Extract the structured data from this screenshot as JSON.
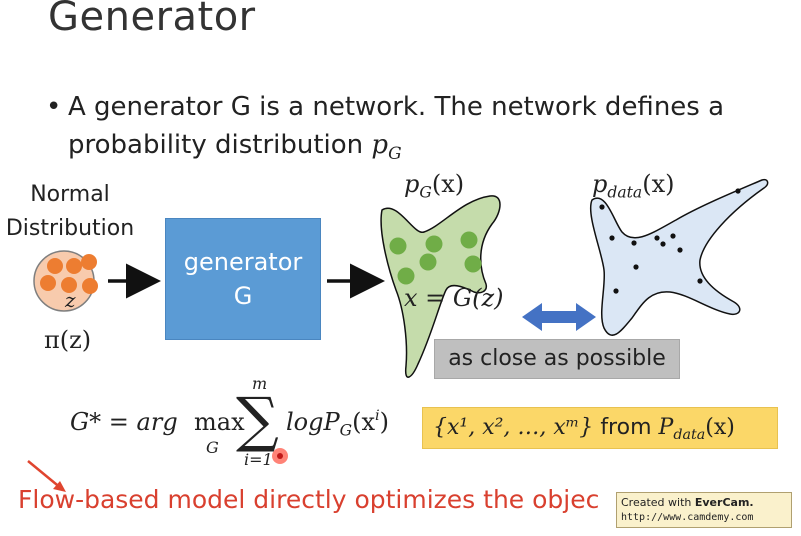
{
  "slide": {
    "title": "Generator",
    "bullet": {
      "text": "A generator G is a network. The network defines a probability distribution",
      "math_symbol": "p",
      "math_sub": "G"
    },
    "normal_label": {
      "line1": "Normal",
      "line2": "Distribution"
    },
    "z_label": "z",
    "pi_label": "π(z)",
    "generator_box": {
      "line1": "generator",
      "line2": "G"
    },
    "pg_label": {
      "symbol": "p",
      "sub": "G",
      "arg": "(x)"
    },
    "pdata_label": {
      "symbol": "p",
      "sub": "data",
      "arg": "(x)"
    },
    "x_eq_label": "x = G(z)",
    "close_box": "as close as possible",
    "formula": {
      "lhs": "G* = arg",
      "max_word": "max",
      "max_sub": "G",
      "sum_top": "m",
      "sum_bottom": "i=1",
      "rhs_main": "logP",
      "rhs_sub": "G",
      "rhs_arg": "(x",
      "rhs_sup": "i",
      "rhs_close": ")"
    },
    "sample_box": {
      "set": "{x¹, x², …, xᵐ}",
      "from_word": "from",
      "P": "P",
      "P_sub": "data",
      "arg": "(x)"
    },
    "flow_text": "Flow-based model directly optimizes the objec",
    "watermark": {
      "created": "Created with",
      "brand": "EverCam.",
      "url": "http://www.camdemy.com"
    },
    "colors": {
      "generator_box": "#5b9bd5",
      "pg_fill": "#c5dcab",
      "pg_dots": "#70ad47",
      "pdata_fill": "#dbe7f5",
      "double_arrow": "#4472c4",
      "close_box": "#bfbfbf",
      "sample_box": "#fbd768",
      "flow_text": "#d9402f",
      "normal_circle": "#f8cbad",
      "normal_dots": "#ed7d31"
    }
  }
}
